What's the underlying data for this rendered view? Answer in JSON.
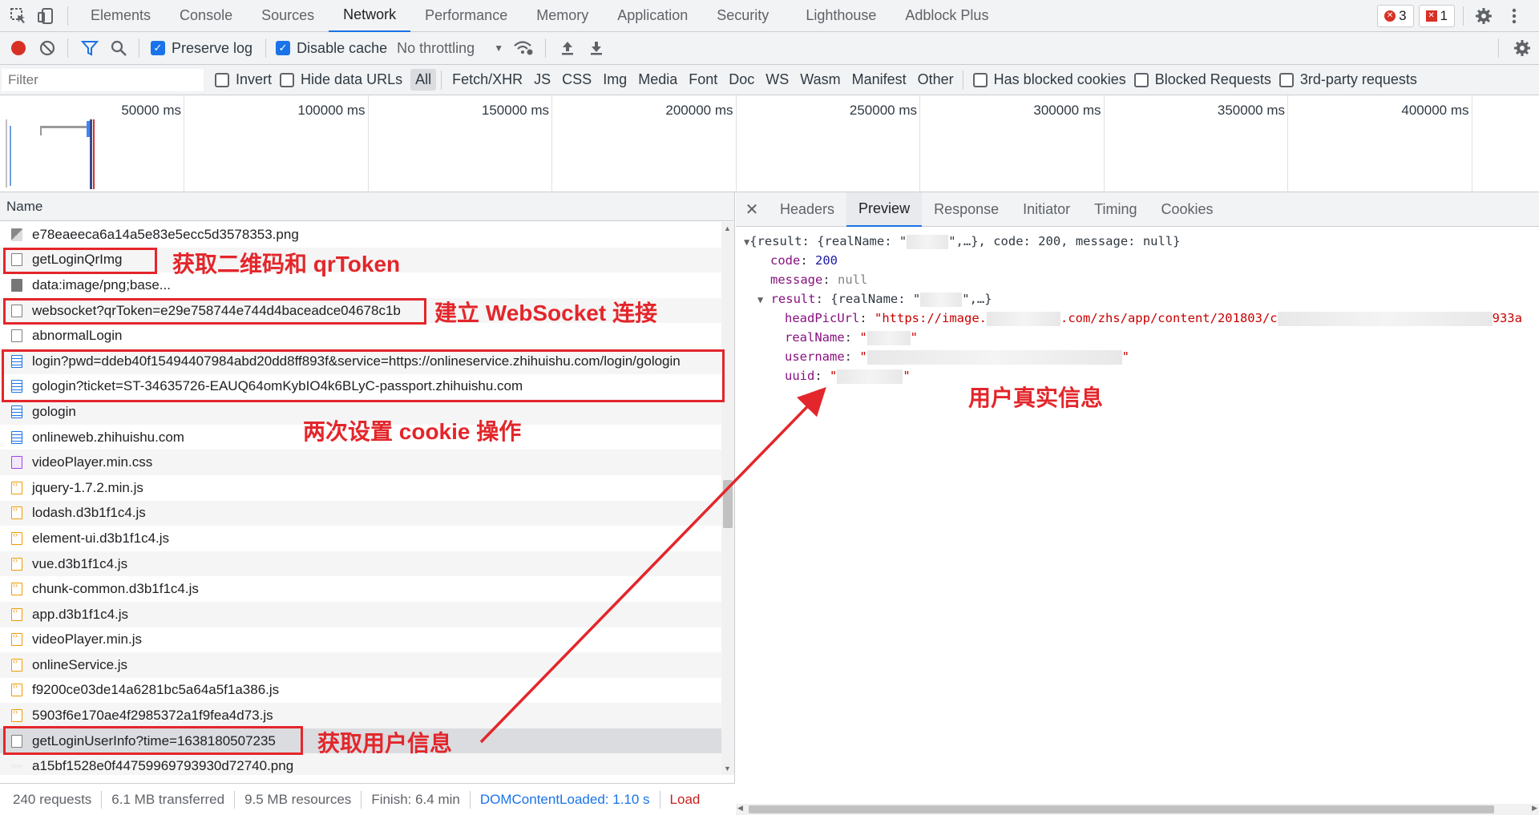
{
  "tabs": [
    "Elements",
    "Console",
    "Sources",
    "Network",
    "Performance",
    "Memory",
    "Application",
    "Security",
    "Lighthouse",
    "Adblock Plus"
  ],
  "active_tab": "Network",
  "counts": {
    "errors": "3",
    "warnings": "1"
  },
  "toolbar": {
    "preserve_log": "Preserve log",
    "disable_cache": "Disable cache",
    "throttling": "No throttling"
  },
  "filter": {
    "placeholder": "Filter",
    "invert": "Invert",
    "hide_data_urls": "Hide data URLs",
    "types": [
      "All",
      "Fetch/XHR",
      "JS",
      "CSS",
      "Img",
      "Media",
      "Font",
      "Doc",
      "WS",
      "Wasm",
      "Manifest",
      "Other"
    ],
    "has_blocked_cookies": "Has blocked cookies",
    "blocked_requests": "Blocked Requests",
    "third_party": "3rd-party requests"
  },
  "timeline_ticks": [
    "50000 ms",
    "100000 ms",
    "150000 ms",
    "200000 ms",
    "250000 ms",
    "300000 ms",
    "350000 ms",
    "400000 ms"
  ],
  "requests_header": "Name",
  "requests": [
    {
      "name": "e78eaeeca6a14a5e83e5ecc5d3578353.png",
      "type": "img"
    },
    {
      "name": "getLoginQrImg",
      "type": "doc"
    },
    {
      "name": "data:image/png;base...",
      "type": "imgdark"
    },
    {
      "name": "websocket?qrToken=e29e758744e744d4baceadce04678c1b",
      "type": "doc"
    },
    {
      "name": "abnormalLogin",
      "type": "doc"
    },
    {
      "name": "login?pwd=ddeb40f15494407984abd20dd8ff893f&service=https://onlineservice.zhihuishu.com/login/gologin",
      "type": "html"
    },
    {
      "name": "gologin?ticket=ST-34635726-EAUQ64omKybIO4k6BLyC-passport.zhihuishu.com",
      "type": "html"
    },
    {
      "name": "gologin",
      "type": "html"
    },
    {
      "name": "onlineweb.zhihuishu.com",
      "type": "html"
    },
    {
      "name": "videoPlayer.min.css",
      "type": "css"
    },
    {
      "name": "jquery-1.7.2.min.js",
      "type": "js"
    },
    {
      "name": "lodash.d3b1f1c4.js",
      "type": "js"
    },
    {
      "name": "element-ui.d3b1f1c4.js",
      "type": "js"
    },
    {
      "name": "vue.d3b1f1c4.js",
      "type": "js"
    },
    {
      "name": "chunk-common.d3b1f1c4.js",
      "type": "js"
    },
    {
      "name": "app.d3b1f1c4.js",
      "type": "js"
    },
    {
      "name": "videoPlayer.min.js",
      "type": "js"
    },
    {
      "name": "onlineService.js",
      "type": "js"
    },
    {
      "name": "f9200ce03de14a6281bc5a64a5f1a386.js",
      "type": "js"
    },
    {
      "name": "5903f6e170ae4f2985372a1f9fea4d73.js",
      "type": "js"
    },
    {
      "name": "getLoginUserInfo?time=1638180507235",
      "type": "doc"
    },
    {
      "name": "a15bf1528e0f44759969793930d72740.png",
      "type": "blank"
    }
  ],
  "status": {
    "requests": "240 requests",
    "transferred": "6.1 MB transferred",
    "resources": "9.5 MB resources",
    "finish": "Finish: 6.4 min",
    "dom_loaded": "DOMContentLoaded: 1.10 s",
    "load": "Load"
  },
  "detail_tabs": [
    "Headers",
    "Preview",
    "Response",
    "Initiator",
    "Timing",
    "Cookies"
  ],
  "active_detail_tab": "Preview",
  "preview": {
    "summary_open": "{result: {realName: \"",
    "summary_close": "\",…}, code: 200, message: null}",
    "code_key": "code",
    "code_val": "200",
    "message_key": "message",
    "message_val": "null",
    "result_key": "result",
    "result_open": "{realName: \"",
    "result_close": "\",…}",
    "headpic_key": "headPicUrl",
    "headpic_a": "\"https://image.",
    "headpic_b": ".com/zhs/app/content/201803/c",
    "headpic_c": "933a",
    "realname_key": "realName",
    "username_key": "username",
    "uuid_key": "uuid",
    "quote": "\""
  },
  "annotations": {
    "qr": "获取二维码和 qrToken",
    "ws": "建立 WebSocket 连接",
    "cookie": "两次设置 cookie 操作",
    "user": "获取用户信息",
    "real": "用户真实信息"
  },
  "colors": {
    "annotation": "#e3262b",
    "accent": "#1a73e8",
    "record": "#d93025"
  }
}
